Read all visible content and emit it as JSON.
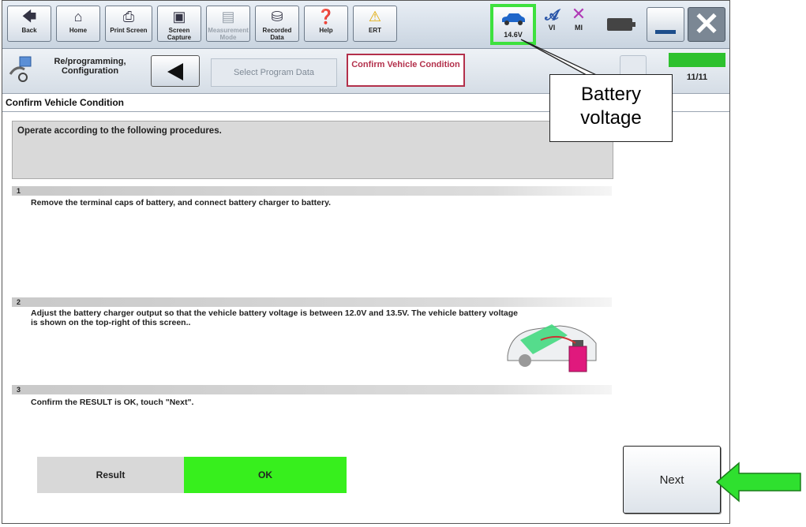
{
  "toolbar": {
    "buttons": [
      {
        "label": "Back",
        "icon": "back-arrow-icon"
      },
      {
        "label": "Home",
        "icon": "home-icon"
      },
      {
        "label": "Print Screen",
        "icon": "printer-icon"
      },
      {
        "label": "Screen Capture",
        "icon": "camera-icon"
      },
      {
        "label": "Measurement Mode",
        "icon": "measurement-icon"
      },
      {
        "label": "Recorded Data",
        "icon": "recorded-data-icon"
      },
      {
        "label": "Help",
        "icon": "help-icon"
      },
      {
        "label": "ERT",
        "icon": "warning-icon"
      }
    ],
    "voltage": "14.6V",
    "vi_label": "VI",
    "mi_label": "MI"
  },
  "navbar": {
    "title": "Re/programming, Configuration",
    "crumbs": [
      "Select Program Data",
      "Confirm Vehicle Condition"
    ],
    "step_count": "11/11"
  },
  "section_title": "Confirm Vehicle Condition",
  "procedure_header": "Operate according to the following procedures.",
  "steps": [
    {
      "num": "1",
      "text": "Remove the terminal caps of battery, and connect battery charger to battery."
    },
    {
      "num": "2",
      "text": "Adjust the battery charger output so that the vehicle battery voltage is between 12.0V and 13.5V. The vehicle battery voltage is shown on the top-right of this screen.."
    },
    {
      "num": "3",
      "text": "Confirm the RESULT is OK, touch \"Next\"."
    }
  ],
  "result": {
    "label": "Result",
    "value": "OK"
  },
  "next_label": "Next",
  "callout_text": "Battery voltage",
  "colors": {
    "highlight": "#3ee13e",
    "ok": "#37ef1d",
    "arrow": "#2fe02f",
    "active_crumb": "#b3304b"
  }
}
